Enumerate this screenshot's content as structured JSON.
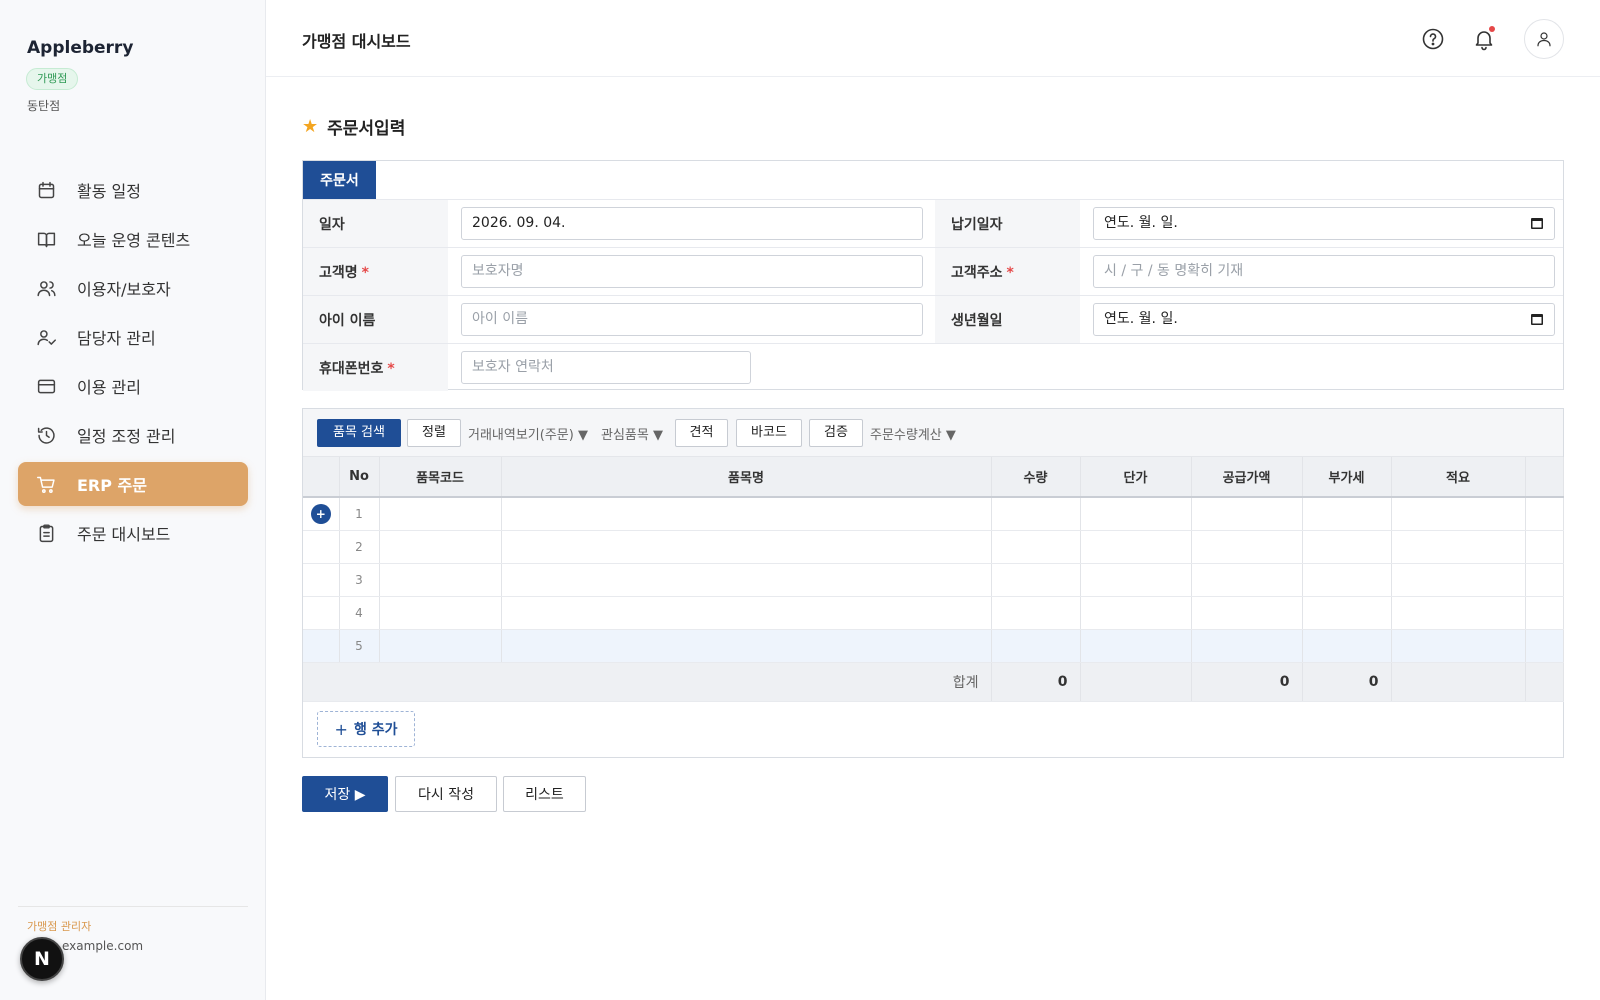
{
  "sidebar": {
    "brand": "Appleberry",
    "badge": "가맹점",
    "branch": "동탄점",
    "items": [
      {
        "label": "활동 일정",
        "icon": "calendar-icon"
      },
      {
        "label": "오늘 운영 콘텐츠",
        "icon": "book-icon"
      },
      {
        "label": "이용자/보호자",
        "icon": "users-icon"
      },
      {
        "label": "담당자 관리",
        "icon": "user-check-icon"
      },
      {
        "label": "이용 관리",
        "icon": "card-icon"
      },
      {
        "label": "일정 조정 관리",
        "icon": "history-icon"
      },
      {
        "label": "ERP 주문",
        "icon": "cart-icon",
        "active": true
      },
      {
        "label": "주문 대시보드",
        "icon": "clipboard-icon"
      }
    ],
    "footer": {
      "role": "가맹점 관리자",
      "email": "example.com"
    },
    "n_badge": "N"
  },
  "header": {
    "title": "가맹점 대시보드"
  },
  "section": {
    "title": "주문서입력",
    "tab": "주문서"
  },
  "form": {
    "date_label": "일자",
    "date_value": "2026. 09. 04.",
    "due_label": "납기일자",
    "due_value": "연도. 월. 일.",
    "customer_label": "고객명",
    "customer_placeholder": "보호자명",
    "address_label": "고객주소",
    "address_placeholder": "시 / 구 / 동 명확히 기재",
    "child_label": "아이 이름",
    "child_placeholder": "아이 이름",
    "birth_label": "생년월일",
    "birth_value": "연도. 월. 일.",
    "phone_label": "휴대폰번호",
    "phone_placeholder": "보호자 연락처",
    "required_mark": "*"
  },
  "toolbar": {
    "search": "품목 검색",
    "sort": "정렬",
    "history": "거래내역보기(주문) ▼",
    "interest": "관심품목 ▼",
    "estimate": "견적",
    "barcode": "바코드",
    "verify": "검증",
    "calc": "주문수량계산 ▼"
  },
  "grid": {
    "columns": [
      "No",
      "품목코드",
      "품목명",
      "수량",
      "단가",
      "공급가액",
      "부가세",
      "적요"
    ],
    "rows": [
      "1",
      "2",
      "3",
      "4",
      "5"
    ],
    "add_marker": "+",
    "sum_label": "합계",
    "sum_qty": "0",
    "sum_supply": "0",
    "sum_vat": "0"
  },
  "add_row": {
    "plus": "+",
    "label": "행 추가"
  },
  "actions": {
    "save": "저장 ▶",
    "reset": "다시 작성",
    "list": "리스트"
  },
  "colors": {
    "primary": "#1f4e96",
    "accent": "#dda468",
    "star": "#f3a521",
    "required": "#e54848"
  }
}
